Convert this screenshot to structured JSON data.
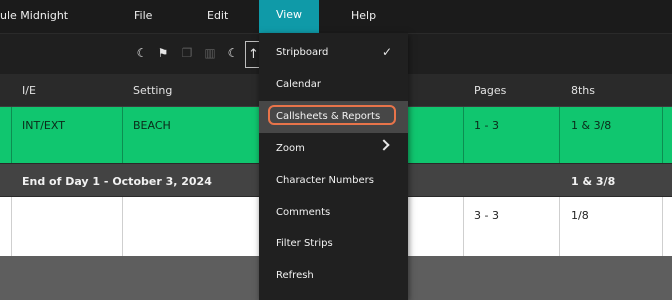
{
  "menubar": {
    "app_title": "ule Midnight",
    "menus": [
      "File",
      "Edit",
      "View",
      "Help"
    ]
  },
  "toolbar": {
    "icons": [
      "moon-icon",
      "flag-icon",
      "duplicate-icon",
      "trash-icon",
      "moon-plus-icon",
      "arrow-up-icon"
    ]
  },
  "table": {
    "headers": [
      "I/E",
      "Setting",
      "Pages",
      "8ths"
    ],
    "rows": [
      {
        "ie": "INT/EXT",
        "setting": "BEACH",
        "pages": "1 - 3",
        "eighths": "1 & 3/8",
        "color": "#10c66f"
      },
      {
        "label": "End of Day 1 - October 3, 2024",
        "eighths": "1 & 3/8"
      },
      {
        "ie": "",
        "setting": "",
        "pages": "3 - 3",
        "eighths": "1/8",
        "color": "#ffffff"
      }
    ]
  },
  "view_menu": {
    "items": [
      {
        "label": "Stripboard",
        "checked": true
      },
      {
        "label": "Calendar"
      },
      {
        "label": "Callsheets & Reports",
        "highlighted": true
      },
      {
        "label": "Zoom",
        "submenu": true
      },
      {
        "label": "Character Numbers"
      },
      {
        "label": "Comments"
      },
      {
        "label": "Filter Strips"
      },
      {
        "label": "Refresh"
      }
    ],
    "highlight_color": "#e8744a",
    "active_menu_color": "#0f9aa8"
  }
}
